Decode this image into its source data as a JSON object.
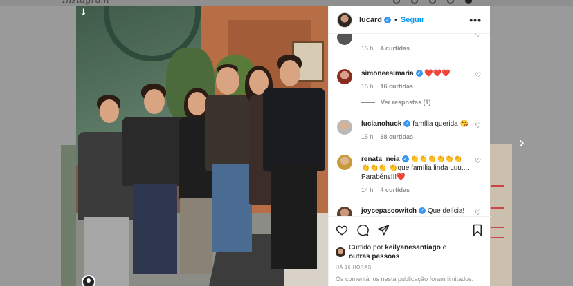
{
  "background": {
    "brand": "Instagram"
  },
  "post": {
    "author": "lucard",
    "verified": true,
    "separator": "•",
    "follow_label": "Seguir",
    "more_label": "•••",
    "photo_alt": "family photo"
  },
  "comments": [
    {
      "username": "",
      "text": "",
      "time": "15 h",
      "likes": "4 curtidas"
    },
    {
      "username": "simoneesimaria",
      "text": "❤️❤️❤️",
      "time": "15 h",
      "likes": "16 curtidas"
    },
    {
      "username": "lucianohuck",
      "text": "família querida 😘",
      "time": "15 h",
      "likes": "38 curtidas"
    },
    {
      "username": "renata_neia",
      "text": "👏👏👏👏👏👏👏👏👏 👏que família linda Luu.... Parabéns!!!❤️",
      "time": "14 h",
      "likes": "4 curtidas"
    },
    {
      "username": "joycepascowitch",
      "text": "Que delícia!",
      "time": "",
      "likes": ""
    }
  ],
  "replies_label": "Ver respostas (1)",
  "liked_by": {
    "prefix": "Curtido por",
    "user": "keilyanesantiago",
    "suffix": "e",
    "others": "outras pessoas"
  },
  "timestamp": "HÁ 16 HORAS",
  "comments_limited": "Os comentários nesta publicação foram limitados.",
  "colors": {
    "accent": "#0095f6",
    "verified": "#3897f0",
    "text": "#262626",
    "muted": "#8e8e8e"
  }
}
